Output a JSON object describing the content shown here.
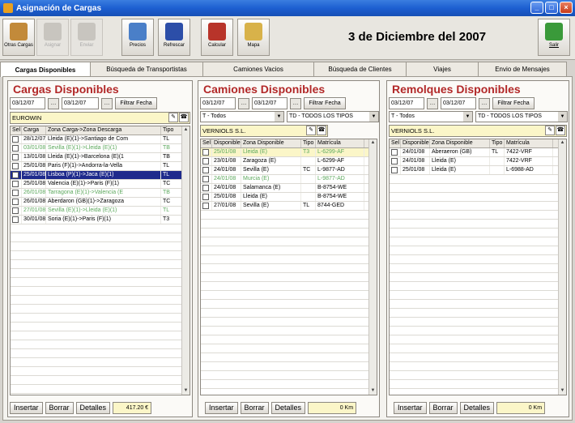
{
  "window": {
    "title": "Asignación de Cargas"
  },
  "toolbar": {
    "buttons": [
      {
        "label": "Otras Cargas",
        "icon": "cargo-box-icon",
        "disabled": false
      },
      {
        "label": "Asignar",
        "icon": "assign-icon",
        "disabled": true
      },
      {
        "label": "Enviar",
        "icon": "send-icon",
        "disabled": true
      },
      {
        "label": "Precios",
        "icon": "prices-icon",
        "disabled": false
      },
      {
        "label": "Refrescar",
        "icon": "refresh-monitor-icon",
        "disabled": false
      },
      {
        "label": "Calcular",
        "icon": "calculator-cross-icon",
        "disabled": false
      },
      {
        "label": "Mapa",
        "icon": "map-icon",
        "disabled": false
      }
    ],
    "exit_label": "Salir",
    "date": "3 de Diciembre del 2007"
  },
  "tabs": [
    "Cargas Disponibles",
    "Búsqueda de Transportistas",
    "Camiones Vacios",
    "Búsqueda de Clientes",
    "Viajes",
    "Envio de Mensajes"
  ],
  "cargas": {
    "title": "Cargas Disponibles",
    "date_from": "03/12/07",
    "date_to": "03/12/07",
    "filter_label": "Filtrar Fecha",
    "client": "EUROWIN",
    "columns": [
      "Sel",
      "Carga",
      "Zona Carga->Zona Descarga",
      "Tipo"
    ],
    "rows": [
      {
        "date": "28/12/07",
        "route": "Lleida   (E)(1)->Santiago de Com",
        "tipo": "TL",
        "style": ""
      },
      {
        "date": "03/01/08",
        "route": "Sevilla   (E)(1)->Lleida   (E)(1)",
        "tipo": "TB",
        "style": "green"
      },
      {
        "date": "13/01/08",
        "route": "Lleida   (E)(1)->Barcelona   (E)(1",
        "tipo": "TB",
        "style": ""
      },
      {
        "date": "25/01/08",
        "route": "Paris   (F)(1)->Andorra-la-Vella",
        "tipo": "TL",
        "style": ""
      },
      {
        "date": "25/01/08",
        "route": "Lisboa   (P)(1)->Jaca   (E)(1)",
        "tipo": "TL",
        "style": "selected"
      },
      {
        "date": "25/01/08",
        "route": "Valencia   (E)(1)->Paris   (F)(1)",
        "tipo": "TC",
        "style": ""
      },
      {
        "date": "26/01/08",
        "route": "Tarragona   (E)(1)->Valencia   (E",
        "tipo": "TB",
        "style": "green"
      },
      {
        "date": "26/01/08",
        "route": "Aberdaron   (GB)(1)->Zaragoza",
        "tipo": "TC",
        "style": ""
      },
      {
        "date": "27/01/08",
        "route": "Sevilla   (E)(1)->Lleida   (E)(1)",
        "tipo": "TL",
        "style": "green"
      },
      {
        "date": "30/01/08",
        "route": "Soria   (E)(1)->Paris   (F)(1)",
        "tipo": "T3",
        "style": ""
      }
    ],
    "buttons": [
      "Insertar",
      "Borrar",
      "Detalles"
    ],
    "total": "417.20 €"
  },
  "camiones": {
    "title": "Camiones Disponibles",
    "date_from": "03/12/07",
    "date_to": "03/12/07",
    "filter_label": "Filtrar Fecha",
    "select_type": "T - Todos",
    "select_all": "TD - TODOS LOS TIPOS",
    "company": "VERNIOLS S.L.",
    "columns": [
      "Sel",
      "Disponible",
      "Zona Disponible",
      "Tipo",
      "Matrícula"
    ],
    "rows": [
      {
        "date": "25/01/08",
        "zona": "Lleida   (E)",
        "tipo": "T3",
        "mat": "L-6299-AF",
        "style": "yellow green"
      },
      {
        "date": "23/01/08",
        "zona": "Zaragoza   (E)",
        "tipo": "",
        "mat": "L-6299-AF",
        "style": ""
      },
      {
        "date": "24/01/08",
        "zona": "Sevilla   (E)",
        "tipo": "TC",
        "mat": "L-9877-AD",
        "style": ""
      },
      {
        "date": "24/01/08",
        "zona": "Murcia   (E)",
        "tipo": "",
        "mat": "L-9877-AD",
        "style": "green"
      },
      {
        "date": "24/01/08",
        "zona": "Salamanca   (E)",
        "tipo": "",
        "mat": "B-8754-WE",
        "style": ""
      },
      {
        "date": "25/01/08",
        "zona": "Lleida   (E)",
        "tipo": "",
        "mat": "B-8754-WE",
        "style": ""
      },
      {
        "date": "27/01/08",
        "zona": "Sevilla   (E)",
        "tipo": "TL",
        "mat": "8744-GED",
        "style": ""
      }
    ],
    "buttons": [
      "Insertar",
      "Borrar",
      "Detalles"
    ],
    "total": "0 Km"
  },
  "remolques": {
    "title": "Remolques Disponibles",
    "date_from": "03/12/07",
    "date_to": "03/12/07",
    "filter_label": "Filtrar Fecha",
    "select_type": "T - Todos",
    "select_all": "TD - TODOS LOS TIPOS",
    "company": "VERNIOLS S.L.",
    "columns": [
      "Sel",
      "Disponible",
      "Zona Disponible",
      "Tipo",
      "Matrícula"
    ],
    "rows": [
      {
        "date": "24/01/08",
        "zona": "Aberaeron   (GB)",
        "tipo": "TL",
        "mat": "7422-VRF",
        "style": ""
      },
      {
        "date": "24/01/08",
        "zona": "Lleida   (E)",
        "tipo": "",
        "mat": "7422-VRF",
        "style": ""
      },
      {
        "date": "25/01/08",
        "zona": "Lleida   (E)",
        "tipo": "",
        "mat": "L-6988-AD",
        "style": ""
      }
    ],
    "buttons": [
      "Insertar",
      "Borrar",
      "Detalles"
    ],
    "total": "0 Km"
  }
}
